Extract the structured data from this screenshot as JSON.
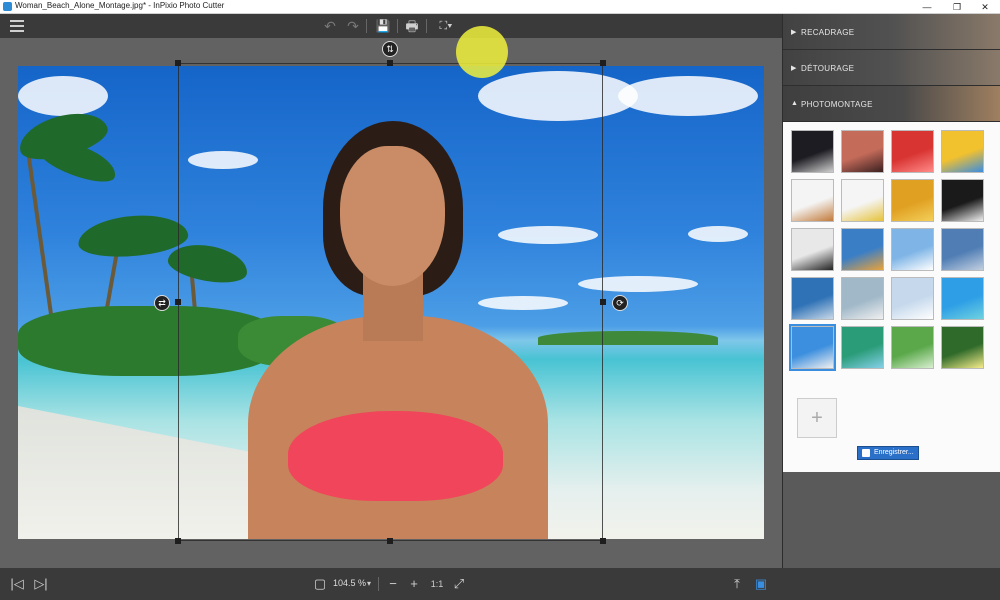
{
  "window": {
    "title": "Woman_Beach_Alone_Montage.jpg* - InPixio Photo Cutter",
    "controls": {
      "minimize": "—",
      "maximize": "❐",
      "close": "✕"
    }
  },
  "toolbar": {
    "menu_icon": "hamburger-icon",
    "undo_icon": "↶",
    "redo_icon": "↷",
    "save_icon": "💾",
    "print_icon": "🖶",
    "share_icon": "⛶▾"
  },
  "canvas": {
    "swap_icon": "⇅",
    "flip_h_icon": "⇄",
    "rotate_icon": "⟳"
  },
  "statusbar": {
    "prev_icon": "|◁",
    "next_icon": "▷|",
    "fit_icon": "▢",
    "zoom_level": "104.5 %",
    "zoom_arrow": "▾",
    "zoom_out_icon": "−",
    "zoom_in_icon": "+",
    "actual_size_label": "1:1",
    "zoom_fit_icon": "⤢",
    "export_icon": "⤒",
    "panel_toggle_icon": "▣"
  },
  "panel": {
    "sections": [
      {
        "label": "RECADRAGE",
        "arrow": "▶",
        "expanded": false
      },
      {
        "label": "DÉTOURAGE",
        "arrow": "▶",
        "expanded": false
      },
      {
        "label": "PHOTOMONTAGE",
        "arrow": "▲",
        "expanded": true
      }
    ],
    "add_label": "+",
    "save_label": "Enregistrer...",
    "thumbnails": [
      {
        "color": "#1c1c22",
        "accent": "#cfcfcf"
      },
      {
        "color": "#c46b5a",
        "accent": "#3a2020"
      },
      {
        "color": "#d83432",
        "accent": "#ff8a88"
      },
      {
        "color": "#f2c12e",
        "accent": "#3b8de0"
      },
      {
        "color": "#f4f4f4",
        "accent": "#c27a3a"
      },
      {
        "color": "#f5f5f5",
        "accent": "#e6c23a"
      },
      {
        "color": "#e0a022",
        "accent": "#f3cf5a"
      },
      {
        "color": "#1a1a1a",
        "accent": "#f0f0f0"
      },
      {
        "color": "#e8e8e8",
        "accent": "#222222"
      },
      {
        "color": "#3a7ec6",
        "accent": "#e9a23a"
      },
      {
        "color": "#7fb5e6",
        "accent": "#ffffff"
      },
      {
        "color": "#4f7db4",
        "accent": "#c2cfe0"
      },
      {
        "color": "#2f72b6",
        "accent": "#c8d8e8"
      },
      {
        "color": "#a0b8c8",
        "accent": "#f0f0f0"
      },
      {
        "color": "#c6d9ec",
        "accent": "#ffffff"
      },
      {
        "color": "#2e9ee6",
        "accent": "#6ed2e0"
      },
      {
        "color": "#3c8fde",
        "accent": "#f0f0f0"
      },
      {
        "color": "#2a9c78",
        "accent": "#85d0e8"
      },
      {
        "color": "#5aa84a",
        "accent": "#d8efd0"
      },
      {
        "color": "#2f6a2a",
        "accent": "#f5ec8a"
      }
    ]
  }
}
